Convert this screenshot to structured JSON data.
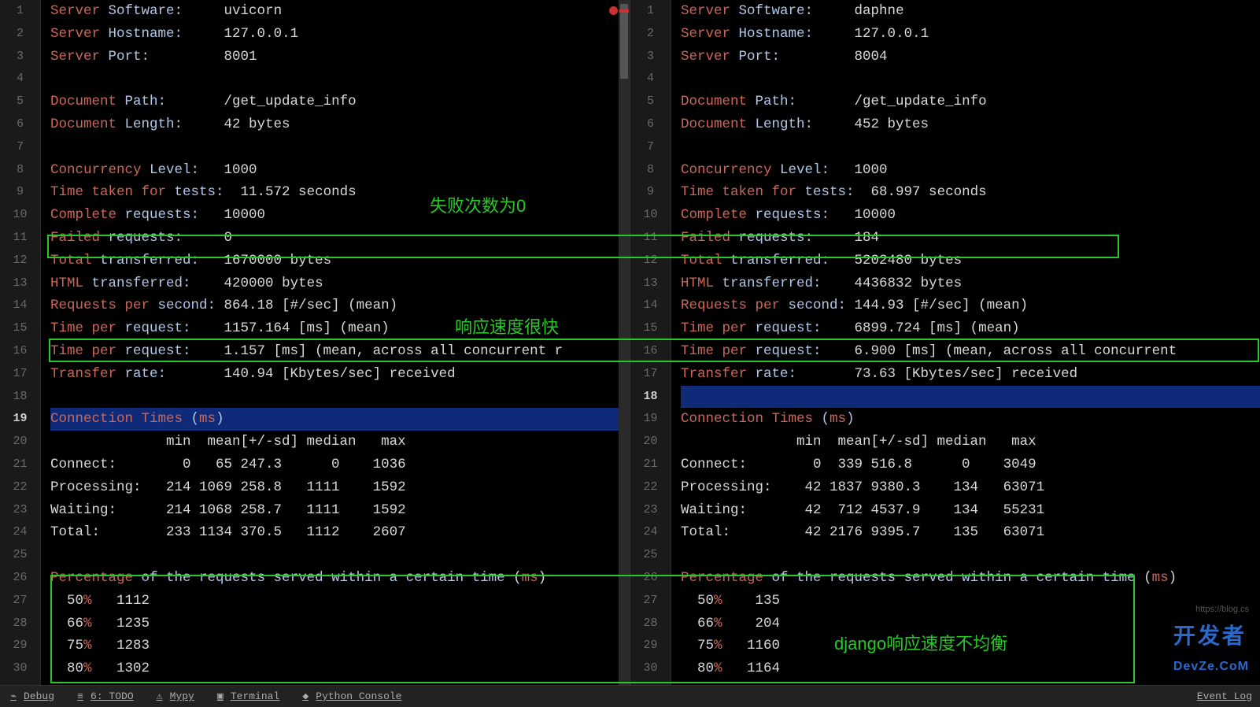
{
  "annotations": {
    "a1": "失败次数为0",
    "a2": "响应速度很快",
    "a3": "django响应速度不均衡"
  },
  "left": {
    "cursor_line": 19,
    "lines": [
      {
        "n": 1,
        "segs": [
          [
            "kw",
            "Server"
          ],
          [
            "id",
            " Software:"
          ],
          [
            "pl",
            "     uvicorn"
          ]
        ]
      },
      {
        "n": 2,
        "segs": [
          [
            "kw",
            "Server"
          ],
          [
            "id",
            " Hostname:"
          ],
          [
            "pl",
            "     127.0.0.1"
          ]
        ]
      },
      {
        "n": 3,
        "segs": [
          [
            "kw",
            "Server"
          ],
          [
            "id",
            " Port:"
          ],
          [
            "pl",
            "         8001"
          ]
        ]
      },
      {
        "n": 4,
        "segs": []
      },
      {
        "n": 5,
        "segs": [
          [
            "kw",
            "Document"
          ],
          [
            "id",
            " Path:"
          ],
          [
            "pl",
            "       /get_update_info"
          ]
        ]
      },
      {
        "n": 6,
        "segs": [
          [
            "kw",
            "Document"
          ],
          [
            "id",
            " Length:"
          ],
          [
            "pl",
            "     42 bytes"
          ]
        ]
      },
      {
        "n": 7,
        "segs": []
      },
      {
        "n": 8,
        "segs": [
          [
            "kw",
            "Concurrency"
          ],
          [
            "id",
            " Level:"
          ],
          [
            "pl",
            "   1000"
          ]
        ]
      },
      {
        "n": 9,
        "segs": [
          [
            "kw",
            "Time taken for"
          ],
          [
            "id",
            " tests:"
          ],
          [
            "pl",
            "  11.572 seconds"
          ]
        ]
      },
      {
        "n": 10,
        "segs": [
          [
            "kw",
            "Complete"
          ],
          [
            "id",
            " requests:"
          ],
          [
            "pl",
            "   10000"
          ]
        ]
      },
      {
        "n": 11,
        "segs": [
          [
            "kw",
            "Failed"
          ],
          [
            "id",
            " requests:"
          ],
          [
            "pl",
            "     0"
          ]
        ]
      },
      {
        "n": 12,
        "segs": [
          [
            "kw",
            "Total"
          ],
          [
            "id",
            " transferred:"
          ],
          [
            "pl",
            "   1670000 bytes"
          ]
        ]
      },
      {
        "n": 13,
        "segs": [
          [
            "kw",
            "HTML"
          ],
          [
            "id",
            " transferred:"
          ],
          [
            "pl",
            "    420000 bytes"
          ]
        ]
      },
      {
        "n": 14,
        "segs": [
          [
            "kw",
            "Requests per"
          ],
          [
            "id",
            " second:"
          ],
          [
            "pl",
            " 864.18 [#/sec] (mean)"
          ]
        ]
      },
      {
        "n": 15,
        "segs": [
          [
            "kw",
            "Time per"
          ],
          [
            "id",
            " request:"
          ],
          [
            "pl",
            "    1157.164 [ms] (mean)"
          ]
        ]
      },
      {
        "n": 16,
        "segs": [
          [
            "kw",
            "Time per"
          ],
          [
            "id",
            " request:"
          ],
          [
            "pl",
            "    1.157 [ms] (mean, across all concurrent r"
          ]
        ]
      },
      {
        "n": 17,
        "segs": [
          [
            "kw",
            "Transfer"
          ],
          [
            "id",
            " rate:"
          ],
          [
            "pl",
            "       140.94 [Kbytes/sec] received"
          ]
        ]
      },
      {
        "n": 18,
        "segs": []
      },
      {
        "n": 19,
        "segs": [
          [
            "kw",
            "Connection Times"
          ],
          [
            "id",
            " ("
          ],
          [
            "kw",
            "ms"
          ],
          [
            "id",
            ")"
          ]
        ]
      },
      {
        "n": 20,
        "segs": [
          [
            "pl",
            "              min  mean[+/-sd] median   max"
          ]
        ]
      },
      {
        "n": 21,
        "segs": [
          [
            "pl",
            "Connect:        0   65 247.3      0    1036"
          ]
        ]
      },
      {
        "n": 22,
        "segs": [
          [
            "pl",
            "Processing:   214 1069 258.8   1111    1592"
          ]
        ]
      },
      {
        "n": 23,
        "segs": [
          [
            "pl",
            "Waiting:      214 1068 258.7   1111    1592"
          ]
        ]
      },
      {
        "n": 24,
        "segs": [
          [
            "pl",
            "Total:        233 1134 370.5   1112    2607"
          ]
        ]
      },
      {
        "n": 25,
        "segs": []
      },
      {
        "n": 26,
        "segs": [
          [
            "kw",
            "Percentage"
          ],
          [
            "id",
            " of the requests served within a certain time"
          ],
          [
            "pl",
            " ("
          ],
          [
            "kw",
            "ms"
          ],
          [
            "pl",
            ")"
          ]
        ]
      },
      {
        "n": 27,
        "segs": [
          [
            "pl",
            "  50"
          ],
          [
            "kw",
            "%"
          ],
          [
            "pl",
            "   1112"
          ]
        ]
      },
      {
        "n": 28,
        "segs": [
          [
            "pl",
            "  66"
          ],
          [
            "kw",
            "%"
          ],
          [
            "pl",
            "   1235"
          ]
        ]
      },
      {
        "n": 29,
        "segs": [
          [
            "pl",
            "  75"
          ],
          [
            "kw",
            "%"
          ],
          [
            "pl",
            "   1283"
          ]
        ]
      },
      {
        "n": 30,
        "segs": [
          [
            "pl",
            "  80"
          ],
          [
            "kw",
            "%"
          ],
          [
            "pl",
            "   1302"
          ]
        ]
      }
    ]
  },
  "right": {
    "cursor_line": 18,
    "lines": [
      {
        "n": 1,
        "segs": [
          [
            "kw",
            "Server"
          ],
          [
            "id",
            " Software:"
          ],
          [
            "pl",
            "     daphne"
          ]
        ]
      },
      {
        "n": 2,
        "segs": [
          [
            "kw",
            "Server"
          ],
          [
            "id",
            " Hostname:"
          ],
          [
            "pl",
            "     127.0.0.1"
          ]
        ]
      },
      {
        "n": 3,
        "segs": [
          [
            "kw",
            "Server"
          ],
          [
            "id",
            " Port:"
          ],
          [
            "pl",
            "         8004"
          ]
        ]
      },
      {
        "n": 4,
        "segs": []
      },
      {
        "n": 5,
        "segs": [
          [
            "kw",
            "Document"
          ],
          [
            "id",
            " Path:"
          ],
          [
            "pl",
            "       /get_update_info"
          ]
        ]
      },
      {
        "n": 6,
        "segs": [
          [
            "kw",
            "Document"
          ],
          [
            "id",
            " Length:"
          ],
          [
            "pl",
            "     452 bytes"
          ]
        ]
      },
      {
        "n": 7,
        "segs": []
      },
      {
        "n": 8,
        "segs": [
          [
            "kw",
            "Concurrency"
          ],
          [
            "id",
            " Level:"
          ],
          [
            "pl",
            "   1000"
          ]
        ]
      },
      {
        "n": 9,
        "segs": [
          [
            "kw",
            "Time taken for"
          ],
          [
            "id",
            " tests:"
          ],
          [
            "pl",
            "  68.997 seconds"
          ]
        ]
      },
      {
        "n": 10,
        "segs": [
          [
            "kw",
            "Complete"
          ],
          [
            "id",
            " requests:"
          ],
          [
            "pl",
            "   10000"
          ]
        ]
      },
      {
        "n": 11,
        "segs": [
          [
            "kw",
            "Failed"
          ],
          [
            "id",
            " requests:"
          ],
          [
            "pl",
            "     184"
          ]
        ]
      },
      {
        "n": 12,
        "segs": [
          [
            "kw",
            "Total"
          ],
          [
            "id",
            " transferred:"
          ],
          [
            "pl",
            "   5202480 bytes"
          ]
        ]
      },
      {
        "n": 13,
        "segs": [
          [
            "kw",
            "HTML"
          ],
          [
            "id",
            " transferred:"
          ],
          [
            "pl",
            "    4436832 bytes"
          ]
        ]
      },
      {
        "n": 14,
        "segs": [
          [
            "kw",
            "Requests per"
          ],
          [
            "id",
            " second:"
          ],
          [
            "pl",
            " 144.93 [#/sec] (mean)"
          ]
        ]
      },
      {
        "n": 15,
        "segs": [
          [
            "kw",
            "Time per"
          ],
          [
            "id",
            " request:"
          ],
          [
            "pl",
            "    6899.724 [ms] (mean)"
          ]
        ]
      },
      {
        "n": 16,
        "segs": [
          [
            "kw",
            "Time per"
          ],
          [
            "id",
            " request:"
          ],
          [
            "pl",
            "    6.900 [ms] (mean, across all concurrent "
          ]
        ]
      },
      {
        "n": 17,
        "segs": [
          [
            "kw",
            "Transfer"
          ],
          [
            "id",
            " rate:"
          ],
          [
            "pl",
            "       73.63 [Kbytes/sec] received"
          ]
        ]
      },
      {
        "n": 18,
        "segs": []
      },
      {
        "n": 19,
        "segs": [
          [
            "kw",
            "Connection Times"
          ],
          [
            "id",
            " ("
          ],
          [
            "kw",
            "ms"
          ],
          [
            "id",
            ")"
          ]
        ]
      },
      {
        "n": 20,
        "segs": [
          [
            "pl",
            "              min  mean[+/-sd] median   max"
          ]
        ]
      },
      {
        "n": 21,
        "segs": [
          [
            "pl",
            "Connect:        0  339 516.8      0    3049"
          ]
        ]
      },
      {
        "n": 22,
        "segs": [
          [
            "pl",
            "Processing:    42 1837 9380.3    134   63071"
          ]
        ]
      },
      {
        "n": 23,
        "segs": [
          [
            "pl",
            "Waiting:       42  712 4537.9    134   55231"
          ]
        ]
      },
      {
        "n": 24,
        "segs": [
          [
            "pl",
            "Total:         42 2176 9395.7    135   63071"
          ]
        ]
      },
      {
        "n": 25,
        "segs": []
      },
      {
        "n": 26,
        "segs": [
          [
            "kw",
            "Percentage"
          ],
          [
            "id",
            " of the requests served within a certain time"
          ],
          [
            "pl",
            " ("
          ],
          [
            "kw",
            "ms"
          ],
          [
            "pl",
            ")"
          ]
        ]
      },
      {
        "n": 27,
        "segs": [
          [
            "pl",
            "  50"
          ],
          [
            "kw",
            "%"
          ],
          [
            "pl",
            "    135"
          ]
        ]
      },
      {
        "n": 28,
        "segs": [
          [
            "pl",
            "  66"
          ],
          [
            "kw",
            "%"
          ],
          [
            "pl",
            "    204"
          ]
        ]
      },
      {
        "n": 29,
        "segs": [
          [
            "pl",
            "  75"
          ],
          [
            "kw",
            "%"
          ],
          [
            "pl",
            "   1160"
          ]
        ]
      },
      {
        "n": 30,
        "segs": [
          [
            "pl",
            "  80"
          ],
          [
            "kw",
            "%"
          ],
          [
            "pl",
            "   1164"
          ]
        ]
      }
    ]
  },
  "watermark": {
    "brand": "开发者",
    "sub": "https://blog.cs",
    "suffix": "DevZe.CoM"
  },
  "status": {
    "items": [
      "Debug",
      "6: TODO",
      "Mypy",
      "Terminal",
      "Python Console"
    ],
    "right": "Event Log"
  }
}
